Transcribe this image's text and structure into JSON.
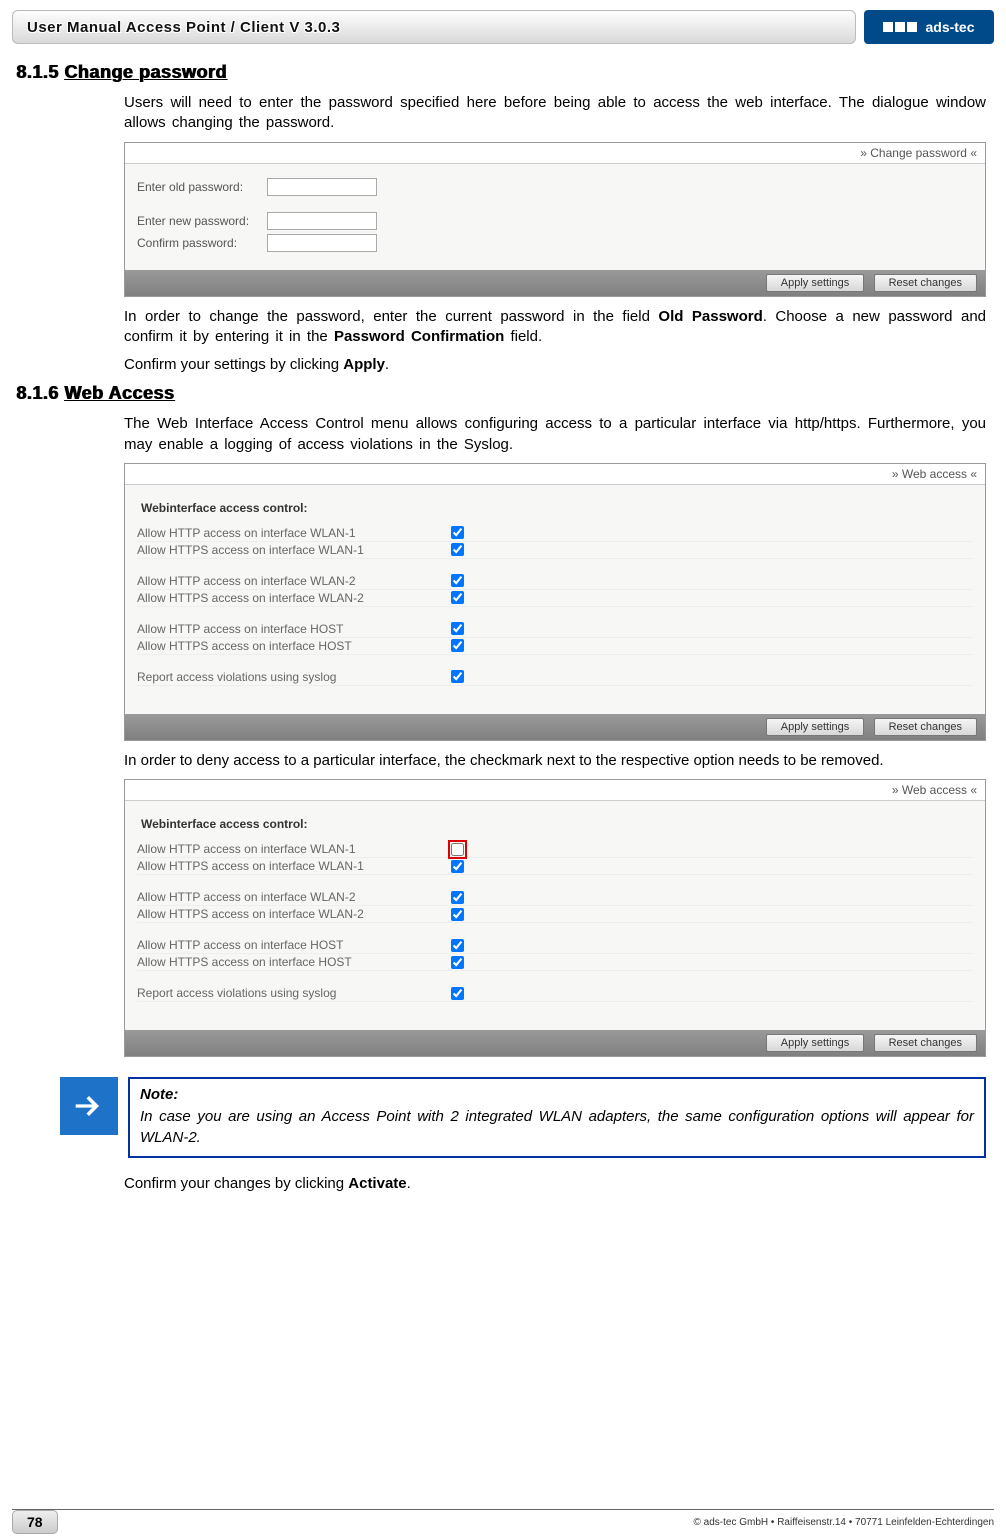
{
  "header": {
    "title": "User Manual Access Point / Client V 3.0.3",
    "logo_text": "ads-tec"
  },
  "section1": {
    "num": "8.1.5",
    "title": "Change password",
    "para1": "Users will need to enter the password specified here before being able to access the web interface. The dialogue window allows changing the password.",
    "panel": {
      "breadcrumb": "» Change password «",
      "row_old": "Enter old password:",
      "row_new": "Enter new password:",
      "row_conf": "Confirm password:",
      "btn_apply": "Apply settings",
      "btn_reset": "Reset changes"
    },
    "para2_a": "In order to change the password, enter the current password in the field ",
    "para2_b": "Old Password",
    "para2_c": ". Choose a new password and confirm it by entering it in the ",
    "para2_d": "Password Confirmation",
    "para2_e": " field.",
    "para3_a": "Confirm your settings by clicking ",
    "para3_b": "Apply",
    "para3_c": "."
  },
  "section2": {
    "num": "8.1.6",
    "title": "Web Access",
    "para1": "The Web Interface Access Control menu allows configuring access to a particular interface via http/https. Furthermore, you may enable a logging of access violations in the Syslog.",
    "panel": {
      "breadcrumb": "» Web access «",
      "subhead": "Webinterface access control:",
      "rows": {
        "r1": "Allow HTTP access on interface WLAN-1",
        "r2": "Allow HTTPS access on interface WLAN-1",
        "r3": "Allow HTTP access on interface WLAN-2",
        "r4": "Allow HTTPS access on interface WLAN-2",
        "r5": "Allow HTTP access on interface HOST",
        "r6": "Allow HTTPS access on interface HOST",
        "r7": "Report access violations using syslog"
      },
      "btn_apply": "Apply settings",
      "btn_reset": "Reset changes"
    },
    "para2": "In order to deny access to a particular interface, the checkmark next to the respective option needs to be removed.",
    "note": {
      "title": "Note:",
      "text": "In case you are using an Access Point with 2 integrated WLAN adapters, the same configuration options will appear for WLAN-2."
    },
    "para3_a": "Confirm your changes by clicking ",
    "para3_b": "Activate",
    "para3_c": "."
  },
  "footer": {
    "page": "78",
    "copyright": "© ads-tec GmbH • Raiffeisenstr.14 • 70771 Leinfelden-Echterdingen"
  }
}
